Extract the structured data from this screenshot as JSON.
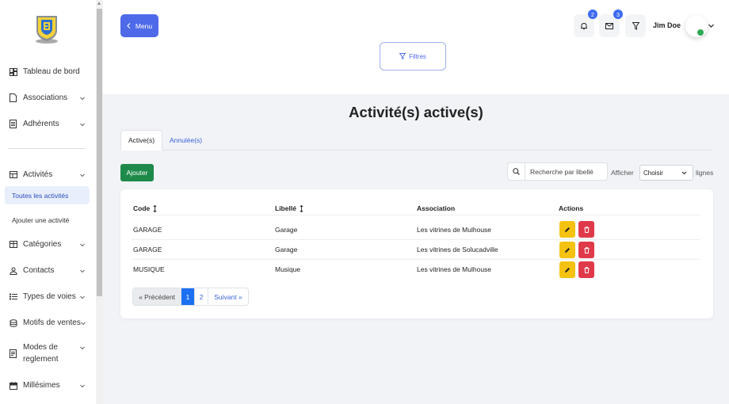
{
  "sidebar": {
    "items": [
      {
        "label": "Tableau de bord",
        "icon": "dashboard-icon"
      },
      {
        "label": "Associations",
        "icon": "file-icon"
      },
      {
        "label": "Adhérents",
        "icon": "list-icon"
      },
      {
        "label": "Activités",
        "icon": "table-icon"
      },
      {
        "label": "Catégories",
        "icon": "grid-icon"
      },
      {
        "label": "Contacts",
        "icon": "user-icon"
      },
      {
        "label": "Types de voies",
        "icon": "list-bullet-icon"
      },
      {
        "label": "Motifs de ventes",
        "icon": "coins-icon"
      },
      {
        "label": "Modes de reglement",
        "icon": "document-icon"
      },
      {
        "label": "Millésimes",
        "icon": "calendar-icon"
      }
    ],
    "sub_items": [
      "Toutes les activités",
      "Ajouter une activité"
    ]
  },
  "header": {
    "menu_label": "Menu",
    "filter_label": "Filtres",
    "notifications_count": "2",
    "messages_count": "3",
    "user_name": "Jim Doe"
  },
  "main": {
    "title": "Activité(s) active(s)",
    "tabs": [
      "Active(s)",
      "Annulée(s)"
    ],
    "add_label": "Ajouter",
    "search_placeholder": "Recherche par libellé",
    "show_label": "Afficher",
    "select_value": "Choisir",
    "lines_label": "lignes"
  },
  "table": {
    "headers": [
      "Code",
      "Libellé",
      "Association",
      "Actions"
    ],
    "rows": [
      {
        "code": "GARAGE",
        "libelle": "Garage",
        "association": "Les vitrines de Mulhouse"
      },
      {
        "code": "GARAGE",
        "libelle": "Garage",
        "association": "Les vitrines de Solucadville"
      },
      {
        "code": "MUSIQUE",
        "libelle": "Musique",
        "association": "Les vitrines de Mulhouse"
      }
    ]
  },
  "pagination": {
    "prev": "« Précédent",
    "pages": [
      "1",
      "2"
    ],
    "next": "Suivant »",
    "current": "1"
  },
  "colors": {
    "primary": "#4f6ae8",
    "success": "#1e8a4a",
    "warning": "#f5c211",
    "danger": "#e03a4a"
  }
}
